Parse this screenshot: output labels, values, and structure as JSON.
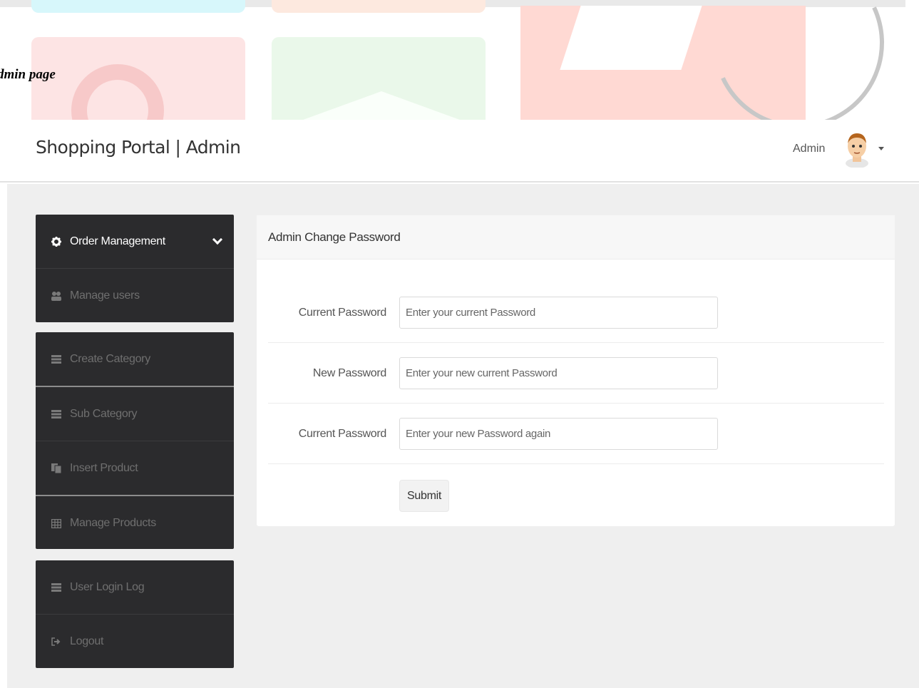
{
  "caption": "dmin page",
  "header": {
    "brand": "Shopping Portal | Admin",
    "user_name": "Admin"
  },
  "sidebar": {
    "groups": [
      {
        "items": [
          {
            "label": "Order Management",
            "icon": "gear-icon",
            "active": true,
            "expandable": true
          },
          {
            "label": "Manage users",
            "icon": "users-icon",
            "active": false
          }
        ]
      },
      {
        "items": [
          {
            "label": "Create Category",
            "icon": "list-icon",
            "active": false
          },
          {
            "label": "Sub Category",
            "icon": "list-icon",
            "active": false
          },
          {
            "label": "Insert Product",
            "icon": "copy-icon",
            "active": false
          },
          {
            "label": "Manage Products",
            "icon": "table-icon",
            "active": false
          }
        ]
      },
      {
        "items": [
          {
            "label": "User Login Log",
            "icon": "list-icon",
            "active": false
          },
          {
            "label": "Logout",
            "icon": "sign-out-icon",
            "active": false
          }
        ]
      }
    ]
  },
  "form": {
    "title": "Admin Change Password",
    "fields": [
      {
        "label": "Current Password",
        "placeholder": "Enter your current Password",
        "value": ""
      },
      {
        "label": "New Password",
        "placeholder": "Enter your new current Password",
        "value": ""
      },
      {
        "label": "Current Password",
        "placeholder": "Enter your new Password again",
        "value": ""
      }
    ],
    "submit_label": "Submit"
  },
  "colors": {
    "sidebar_bg": "#2b2b2d",
    "main_bg": "#efefef",
    "panel_head_bg": "#f7f7f7"
  }
}
